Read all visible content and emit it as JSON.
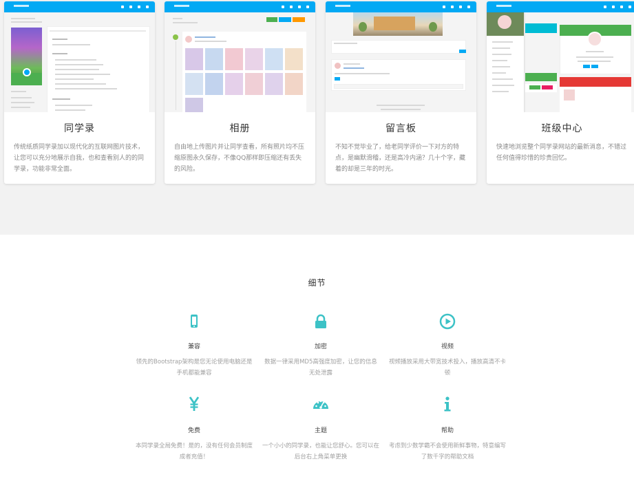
{
  "cards": [
    {
      "title": "同学录",
      "desc": "传统纸质同学录加以现代化的互联网图片技术，让您可以充分地展示自我，也和查看别人的的同学录，功能非常全面。"
    },
    {
      "title": "相册",
      "desc": "自由地上传图片并让同学查看，所有照片均不压缩原图永久保存，不像QQ那样即压缩还有丢失的风险。"
    },
    {
      "title": "留言板",
      "desc": "不知不觉毕业了，给老同学评价一下对方的特点，是幽默滑稽，还是高冷内涵？几十个字，藏着的却是三年的时光。"
    },
    {
      "title": "班级中心",
      "desc": "快速地浏览整个同学录网站的最新消息，不错过任何值得珍惜的珍贵回忆。"
    }
  ],
  "details_title": "细节",
  "features": [
    {
      "name": "兼容",
      "icon": "mobile-icon",
      "desc": "领先的Bootstrap架构是您无论使用电脑还是手机都能兼容"
    },
    {
      "name": "加密",
      "icon": "lock-icon",
      "desc": "数据一律采用MD5高强度加密，让您的信息无处泄露"
    },
    {
      "name": "视频",
      "icon": "play-icon",
      "desc": "视频播放采用大带宽技术投入，播放高清不卡顿"
    },
    {
      "name": "免费",
      "icon": "yen-icon",
      "desc": "本同学录全局免费！是的，没有任何会员制度成者充值！"
    },
    {
      "name": "主题",
      "icon": "dashboard-icon",
      "desc": "一个小小的同学录，也能让您舒心。您可以在后台右上角菜单更换"
    },
    {
      "name": "帮助",
      "icon": "info-icon",
      "desc": "考虑到少数学霸不会使用新鲜事物，特意编写了数千字的帮助文档"
    }
  ],
  "colors": {
    "accent": "#3cc2c6",
    "topbar": "#03a9f4",
    "section_bg": "#f2f2f2"
  }
}
